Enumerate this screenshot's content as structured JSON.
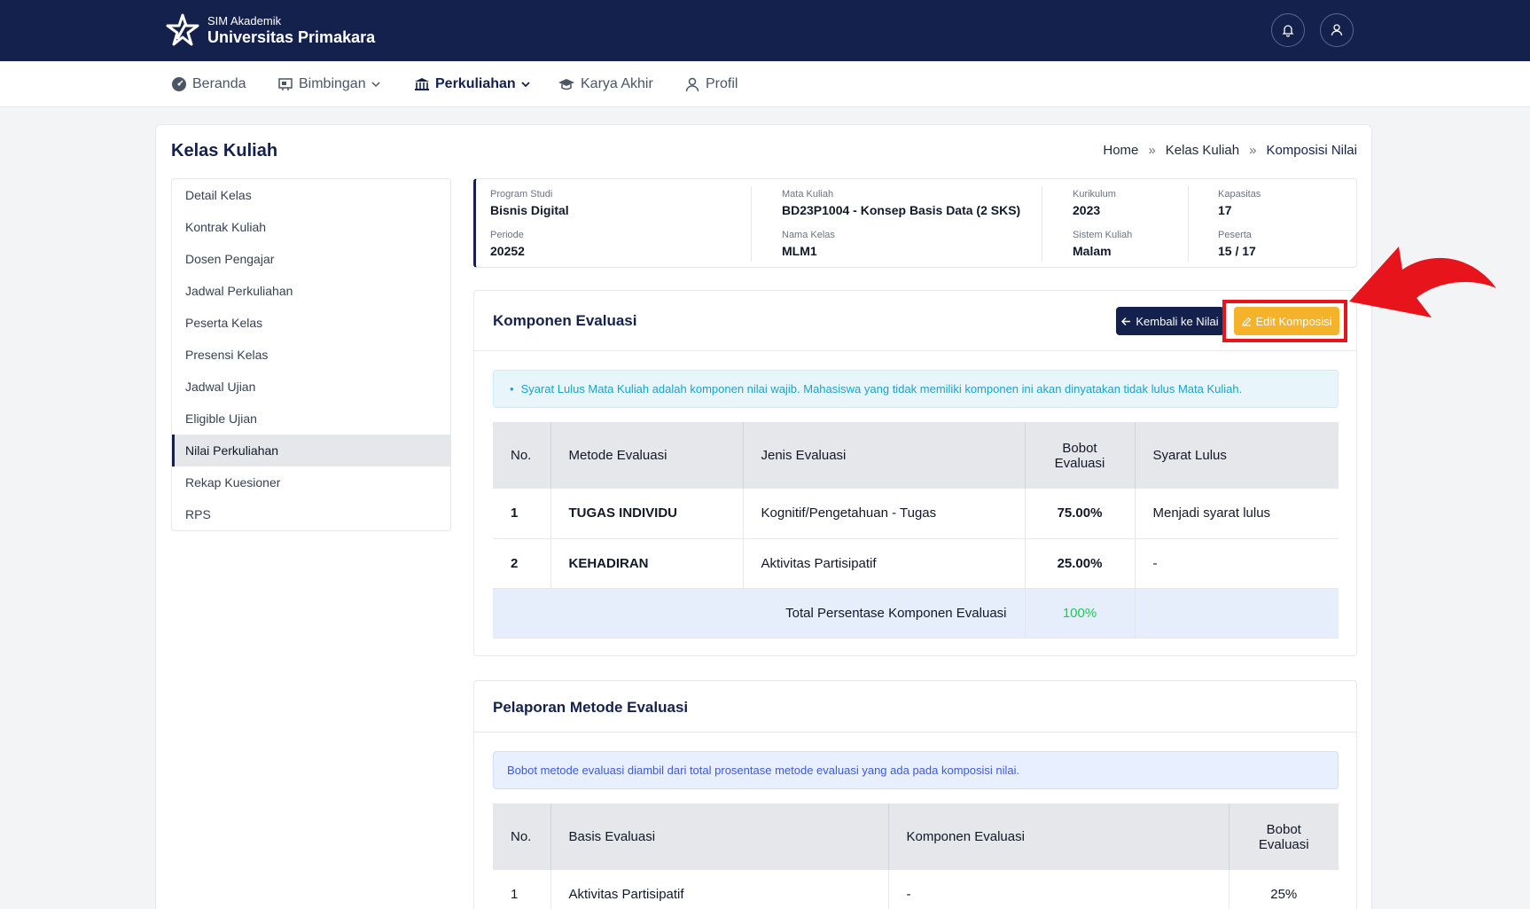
{
  "header": {
    "app_small": "SIM Akademik",
    "app_name": "Universitas Primakara"
  },
  "nav": {
    "items": [
      {
        "label": "Beranda",
        "icon": "dashboard-icon"
      },
      {
        "label": "Bimbingan",
        "icon": "presentation-icon"
      },
      {
        "label": "Perkuliahan",
        "icon": "university-icon"
      },
      {
        "label": "Karya Akhir",
        "icon": "graduation-cap-icon"
      },
      {
        "label": "Profil",
        "icon": "user-icon"
      }
    ]
  },
  "page": {
    "title": "Kelas Kuliah",
    "breadcrumb": [
      "Home",
      "Kelas Kuliah",
      "Komposisi Nilai"
    ],
    "breadcrumb_sep": "»"
  },
  "sidemenu": {
    "items": [
      "Detail Kelas",
      "Kontrak Kuliah",
      "Dosen Pengajar",
      "Jadwal Perkuliahan",
      "Peserta Kelas",
      "Presensi Kelas",
      "Jadwal Ujian",
      "Eligible Ujian",
      "Nilai Perkuliahan",
      "Rekap Kuesioner",
      "RPS"
    ],
    "active": "Nilai Perkuliahan"
  },
  "info": {
    "program_studi": {
      "label": "Program Studi",
      "value": "Bisnis Digital"
    },
    "mata_kuliah": {
      "label": "Mata Kuliah",
      "value": "BD23P1004 - Konsep Basis Data (2 SKS)"
    },
    "kurikulum": {
      "label": "Kurikulum",
      "value": "2023"
    },
    "kapasitas": {
      "label": "Kapasitas",
      "value": "17"
    },
    "periode": {
      "label": "Periode",
      "value": "20252"
    },
    "nama_kelas": {
      "label": "Nama Kelas",
      "value": "MLM1"
    },
    "sistem_kuliah": {
      "label": "Sistem Kuliah",
      "value": "Malam"
    },
    "peserta": {
      "label": "Peserta",
      "value": "15 / 17"
    }
  },
  "komponen": {
    "title": "Komponen Evaluasi",
    "back_label": "Kembali ke Nilai",
    "edit_label": "Edit Komposisi",
    "alert": "Syarat Lulus Mata Kuliah adalah komponen nilai wajib. Mahasiswa yang tidak memiliki komponen ini akan dinyatakan tidak lulus Mata Kuliah.",
    "headers": {
      "no": "No.",
      "metode": "Metode Evaluasi",
      "jenis": "Jenis Evaluasi",
      "bobot_1": "Bobot",
      "bobot_2": "Evaluasi",
      "syarat": "Syarat Lulus"
    },
    "rows": [
      {
        "no": "1",
        "metode": "TUGAS INDIVIDU",
        "jenis": "Kognitif/Pengetahuan - Tugas",
        "bobot": "75.00%",
        "syarat": "Menjadi syarat lulus"
      },
      {
        "no": "2",
        "metode": "KEHADIRAN",
        "jenis": "Aktivitas Partisipatif",
        "bobot": "25.00%",
        "syarat": "-"
      }
    ],
    "total_label": "Total Persentase Komponen Evaluasi",
    "total_value": "100%"
  },
  "pelaporan": {
    "title": "Pelaporan Metode Evaluasi",
    "alert": "Bobot metode evaluasi diambil dari total prosentase metode evaluasi yang ada pada komposisi nilai.",
    "headers": {
      "no": "No.",
      "basis": "Basis Evaluasi",
      "komponen": "Komponen Evaluasi",
      "bobot_1": "Bobot",
      "bobot_2": "Evaluasi"
    },
    "rows": [
      {
        "no": "1",
        "basis": "Aktivitas Partisipatif",
        "komponen": "-",
        "bobot": "25%"
      }
    ]
  },
  "colors": {
    "navy": "#14214d",
    "accent_yellow": "#f5b32c",
    "highlight_red": "#e8141c",
    "success_green": "#22c55e"
  }
}
